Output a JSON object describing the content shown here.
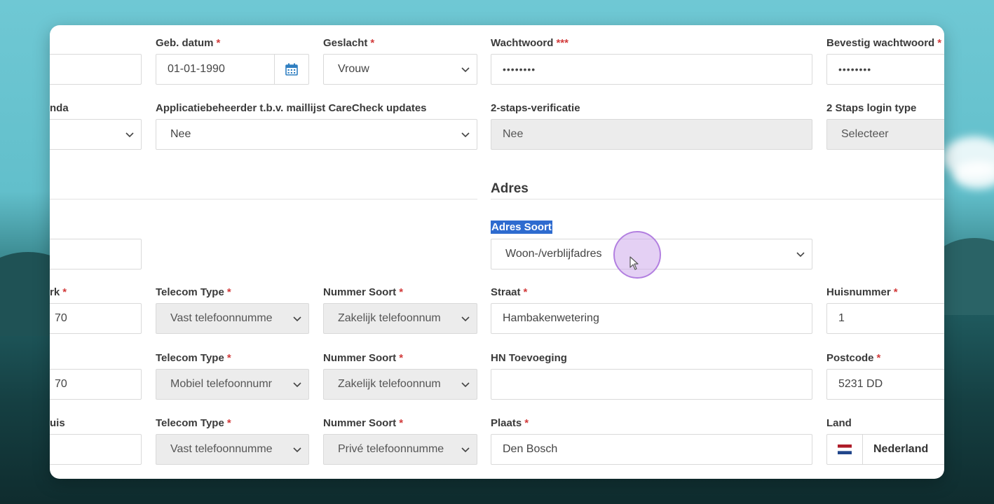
{
  "row1": {
    "dob": {
      "label": "Geb. datum",
      "required": "*",
      "value": "01-01-1990"
    },
    "gender": {
      "label": "Geslacht",
      "required": "*",
      "value": "Vrouw"
    },
    "password": {
      "label": "Wachtwoord",
      "required": "***",
      "value": "••••••••"
    },
    "confirm_password": {
      "label": "Bevestig wachtwoord",
      "required": "*",
      "value": "••••••••"
    }
  },
  "row2": {
    "partial_label": "nda",
    "app_admin": {
      "label": "Applicatiebeheerder t.b.v. maillijst CareCheck updates",
      "value": "Nee"
    },
    "two_step": {
      "label": "2-staps-verificatie",
      "value": "Nee"
    },
    "two_step_type": {
      "label": "2 Staps login type",
      "value": "Selecteer"
    }
  },
  "address": {
    "section_title": "Adres",
    "type": {
      "label": "Adres Soort",
      "value": "Woon-/verblijfadres"
    },
    "street": {
      "label": "Straat",
      "required": "*",
      "value": "Hambakenwetering"
    },
    "house_number": {
      "label": "Huisnummer",
      "required": "*",
      "value": "1"
    },
    "hn_addition": {
      "label": "HN Toevoeging",
      "value": ""
    },
    "postcode": {
      "label": "Postcode",
      "required": "*",
      "value": "5231 DD"
    },
    "city": {
      "label": "Plaats",
      "required": "*",
      "value": "Den Bosch"
    },
    "country": {
      "label": "Land",
      "value": "Nederland"
    }
  },
  "telecom": [
    {
      "partial_label": "rk",
      "partial_required": "*",
      "partial_value": "70",
      "type_label": "Telecom Type",
      "type_required": "*",
      "type_value": "Vast telefoonnumme",
      "kind_label": "Nummer Soort",
      "kind_required": "*",
      "kind_value": "Zakelijk telefoonnum"
    },
    {
      "partial_label": "",
      "partial_required": "",
      "partial_value": "70",
      "type_label": "Telecom Type",
      "type_required": "*",
      "type_value": "Mobiel telefoonnumr",
      "kind_label": "Nummer Soort",
      "kind_required": "*",
      "kind_value": "Zakelijk telefoonnum"
    },
    {
      "partial_label": "uis",
      "partial_required": "",
      "partial_value": "",
      "type_label": "Telecom Type",
      "type_required": "*",
      "type_value": "Vast telefoonnumme",
      "kind_label": "Nummer Soort",
      "kind_required": "*",
      "kind_value": "Privé telefoonnumme"
    }
  ],
  "colors": {
    "required": "#d23b3b",
    "highlight": "#2e6bcf",
    "calendar_icon": "#2f7fc1",
    "cursor_ring": "#b27fe0"
  }
}
